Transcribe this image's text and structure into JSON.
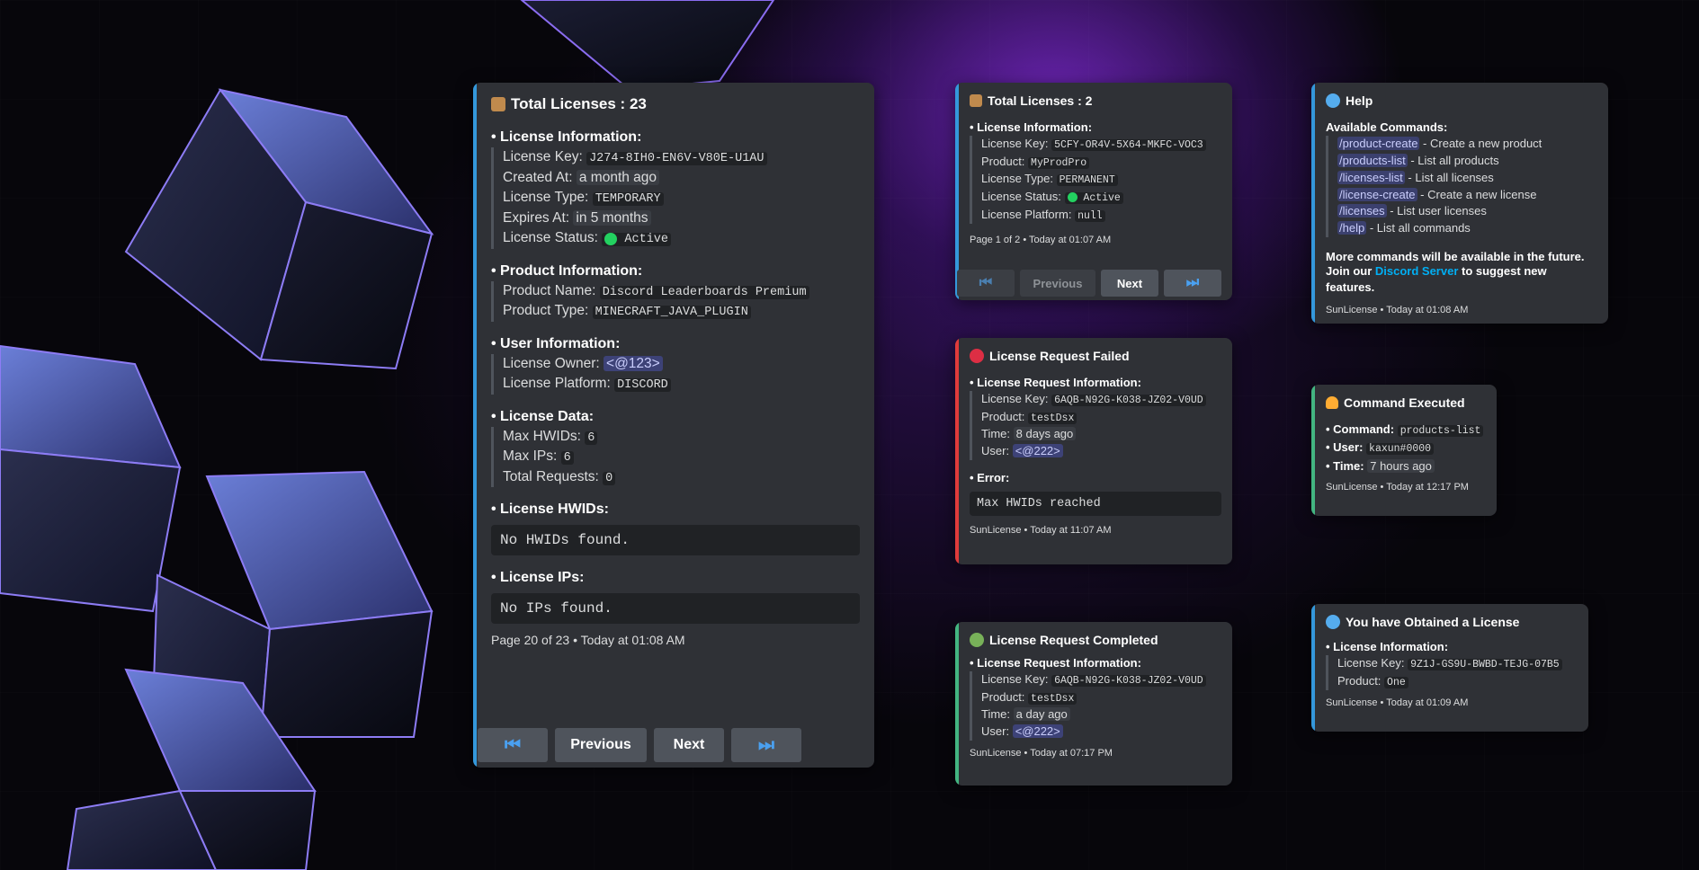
{
  "main": {
    "title": "Total Licenses : 23",
    "license_info_header": "License Information:",
    "license_key_label": "License Key:",
    "license_key": "J274-8IH0-EN6V-V80E-U1AU",
    "created_at_label": "Created At:",
    "created_at": "a month ago",
    "license_type_label": "License Type:",
    "license_type": "TEMPORARY",
    "expires_at_label": "Expires At:",
    "expires_at": "in 5 months",
    "license_status_label": "License Status:",
    "license_status": "Active",
    "product_info_header": "Product Information:",
    "product_name_label": "Product Name:",
    "product_name": "Discord Leaderboards Premium",
    "product_type_label": "Product Type:",
    "product_type": "MINECRAFT_JAVA_PLUGIN",
    "user_info_header": "User Information:",
    "license_owner_label": "License Owner:",
    "license_owner": "<@123>",
    "license_platform_label": "License Platform:",
    "license_platform": "DISCORD",
    "license_data_header": "License Data:",
    "max_hwids_label": "Max HWIDs:",
    "max_hwids": "6",
    "max_ips_label": "Max IPs:",
    "max_ips": "6",
    "total_requests_label": "Total Requests:",
    "total_requests": "0",
    "hwids_header": "License HWIDs:",
    "hwids_value": "No HWIDs found.",
    "ips_header": "License IPs:",
    "ips_value": "No IPs found.",
    "footer": "Page 20 of 23 • Today at 01:08 AM",
    "buttons": {
      "first": "⏮",
      "previous": "Previous",
      "next": "Next",
      "last": "⏭"
    }
  },
  "small_list": {
    "title": "Total Licenses : 2",
    "info_header": "License Information:",
    "license_key_label": "License Key:",
    "license_key": "5CFY-OR4V-5X64-MKFC-VOC3",
    "product_label": "Product:",
    "product": "MyProdPro",
    "license_type_label": "License Type:",
    "license_type": "PERMANENT",
    "license_status_label": "License Status:",
    "license_status": "Active",
    "license_platform_label": "License Platform:",
    "license_platform": "null",
    "footer": "Page 1 of 2 •  Today at 01:07 AM",
    "buttons": {
      "first": "⏮",
      "previous": "Previous",
      "next": "Next",
      "last": "⏭"
    }
  },
  "failed": {
    "title": "License Request Failed",
    "info_header": "License Request Information:",
    "license_key_label": "License Key:",
    "license_key": "6AQB-N92G-K038-JZ02-V0UD",
    "product_label": "Product:",
    "product": "testDsx",
    "time_label": "Time:",
    "time": "8 days ago",
    "user_label": "User:",
    "user": "<@222>",
    "error_header": "Error:",
    "error": "Max HWIDs reached",
    "footer": "SunLicense • Today at 11:07 AM"
  },
  "completed": {
    "title": "License Request Completed",
    "info_header": "License Request Information:",
    "license_key_label": "License Key:",
    "license_key": "6AQB-N92G-K038-JZ02-V0UD",
    "product_label": "Product:",
    "product": "testDsx",
    "time_label": "Time:",
    "time": "a day ago",
    "user_label": "User:",
    "user": "<@222>",
    "footer": "SunLicense • Today at 07:17 PM"
  },
  "help": {
    "title": "Help",
    "commands_header": "Available Commands:",
    "commands": [
      {
        "cmd": "/product-create",
        "desc": " - Create a new product"
      },
      {
        "cmd": "/products-list",
        "desc": " - List all products"
      },
      {
        "cmd": "/licenses-list",
        "desc": " - List all licenses"
      },
      {
        "cmd": "/license-create",
        "desc": " - Create a new license"
      },
      {
        "cmd": "/licenses",
        "desc": " - List user licenses"
      },
      {
        "cmd": "/help",
        "desc": " - List all commands"
      }
    ],
    "more_line": "More commands will be available in the future.",
    "join_prefix": "Join our ",
    "join_link": "Discord Server",
    "join_suffix": " to suggest new features.",
    "footer": "SunLicense • Today at 01:08 AM"
  },
  "executed": {
    "title": "Command Executed",
    "command_label": "Command:",
    "command": "products-list",
    "user_label": "User:",
    "user": "kaxun#0000",
    "time_label": "Time:",
    "time": "7 hours ago",
    "footer": "SunLicense • Today at 12:17 PM"
  },
  "obtained": {
    "title": "You have Obtained a License",
    "info_header": "License Information:",
    "license_key_label": "License Key:",
    "license_key": "9Z1J-GS9U-BWBD-TEJG-07B5",
    "product_label": "Product:",
    "product": "One",
    "footer": "SunLicense • Today at 01:09 AM"
  },
  "colors": {
    "accent_blue": "#3498db",
    "error_red": "#e03b3b",
    "success_green": "#43b581",
    "status_active": "#23d160"
  }
}
